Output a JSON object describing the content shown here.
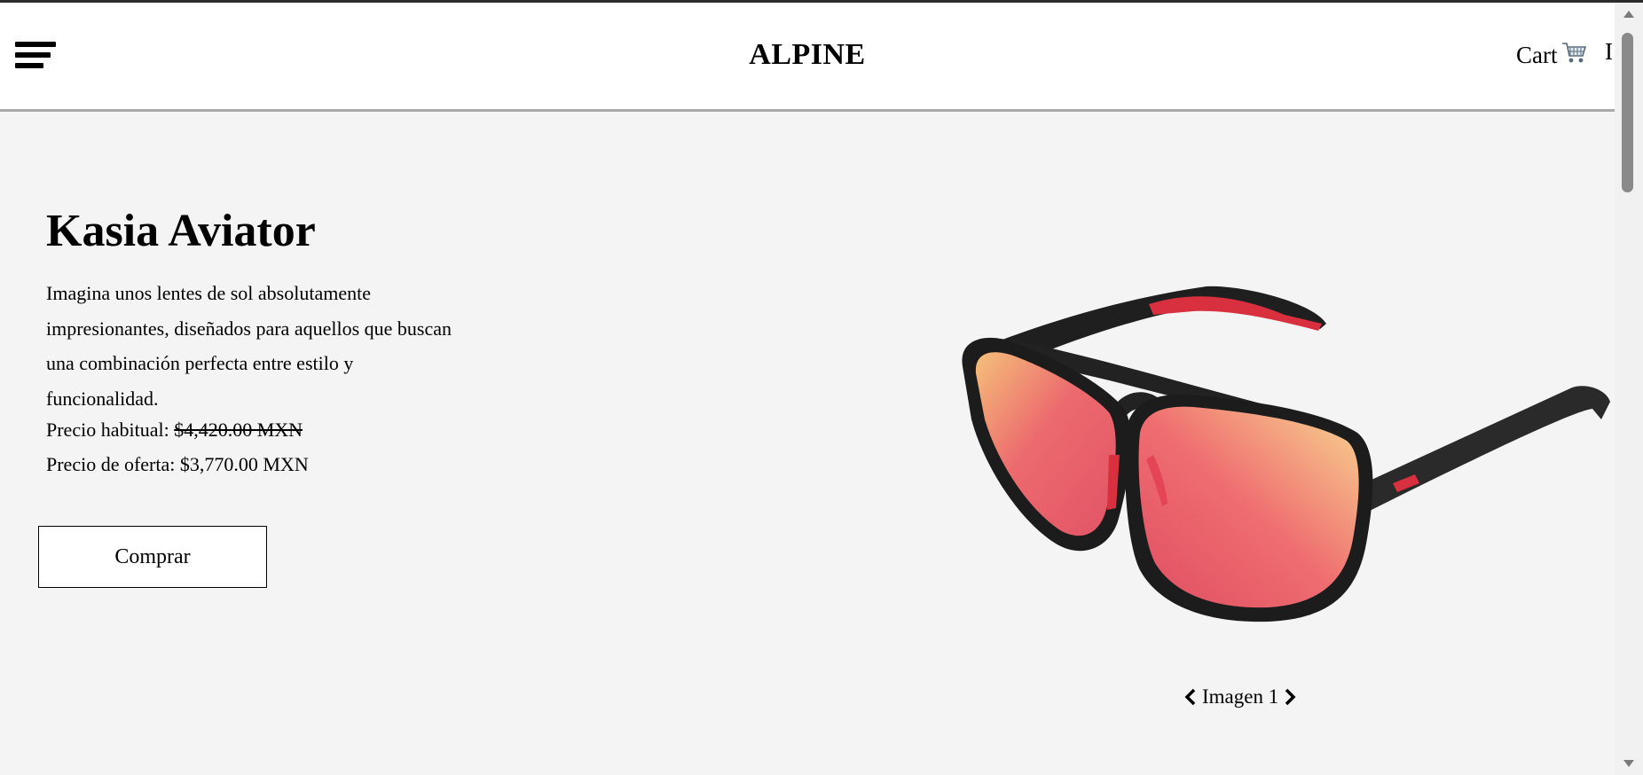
{
  "header": {
    "menu_icon": "hamburger-menu-icon",
    "brand": "ALPINE",
    "cart_label": "Cart",
    "cart_icon": "shopping-cart-icon",
    "extra_text": "I"
  },
  "product": {
    "name": "Kasia Aviator",
    "description": "Imagina unos lentes de sol absolutamente impresionantes, diseñados para aquellos que buscan una combinación perfecta entre estilo y funcionalidad.",
    "regular_price_label": "Precio habitual:",
    "regular_price": "$4,420.00 MXN",
    "sale_price_label": "Precio de oferta:",
    "sale_price": "$3,770.00 MXN",
    "buy_label": "Comprar"
  },
  "carousel": {
    "label": "Imagen 1",
    "prev_icon": "chevron-left-icon",
    "next_icon": "chevron-right-icon"
  },
  "colors": {
    "page_background": "#f4f4f4",
    "header_background": "#ffffff",
    "lens_red": "#ef5a6a",
    "frame_black": "#1e1e1e"
  }
}
